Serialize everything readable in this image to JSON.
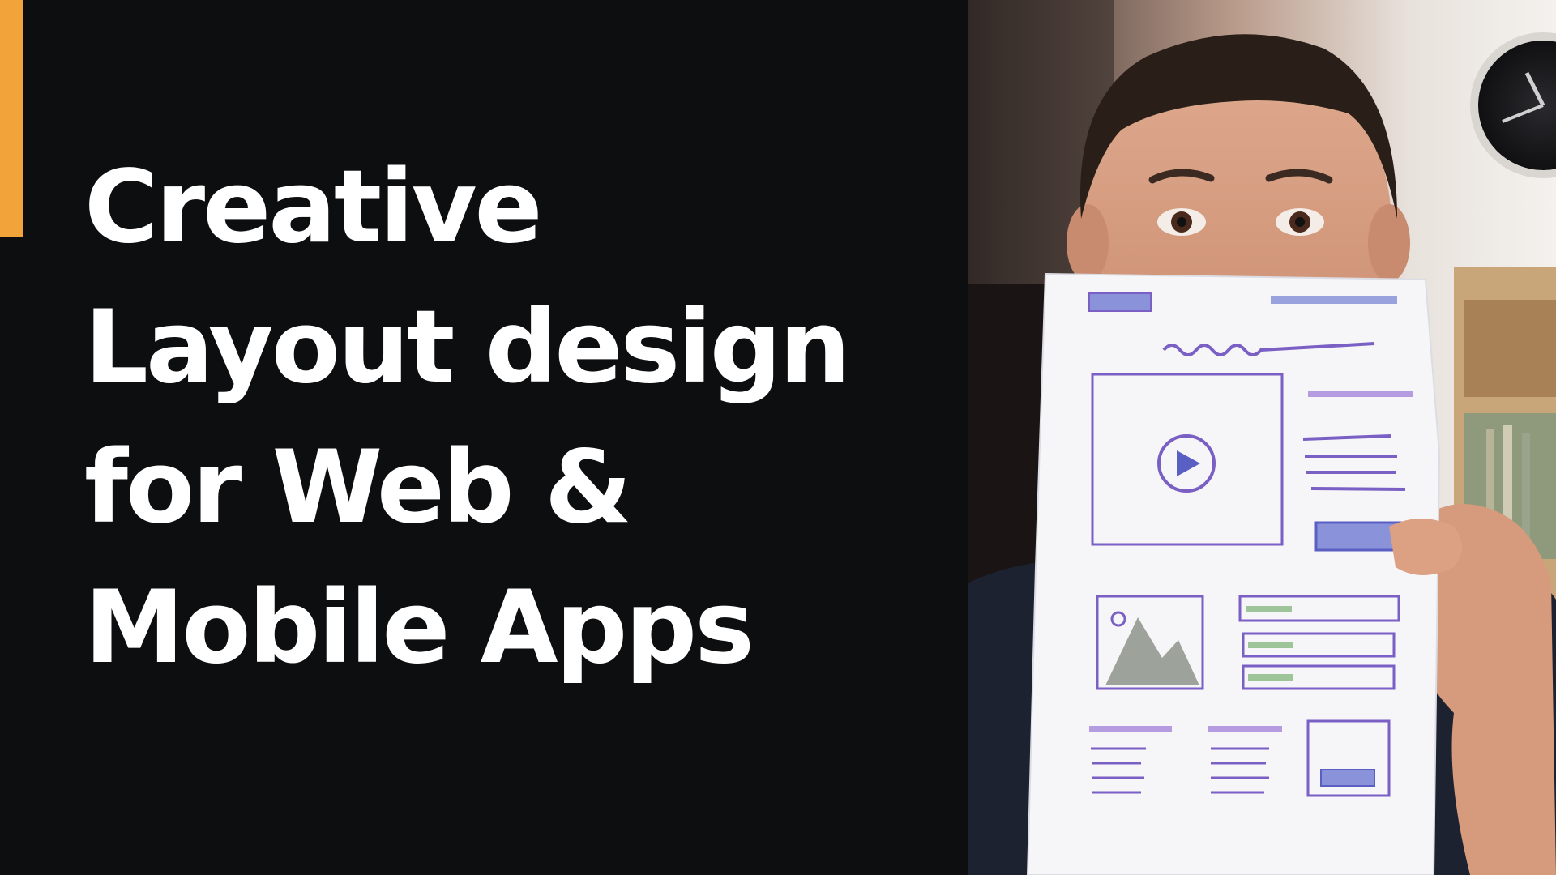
{
  "title": {
    "lines": [
      "Creative",
      "Layout design",
      "for Web &",
      "Mobile Apps"
    ]
  },
  "colors": {
    "background": "#0d0e10",
    "accent": "#f2a33a",
    "title_text": "#ffffff",
    "sketch_ink": "#7a5fc4",
    "sketch_fill": "#8a93d9"
  },
  "photo": {
    "subject": "person holding a hand-drawn wireframe sketch in front of face",
    "icons": [
      "play-icon",
      "mountain-image-icon",
      "clock-icon"
    ]
  }
}
